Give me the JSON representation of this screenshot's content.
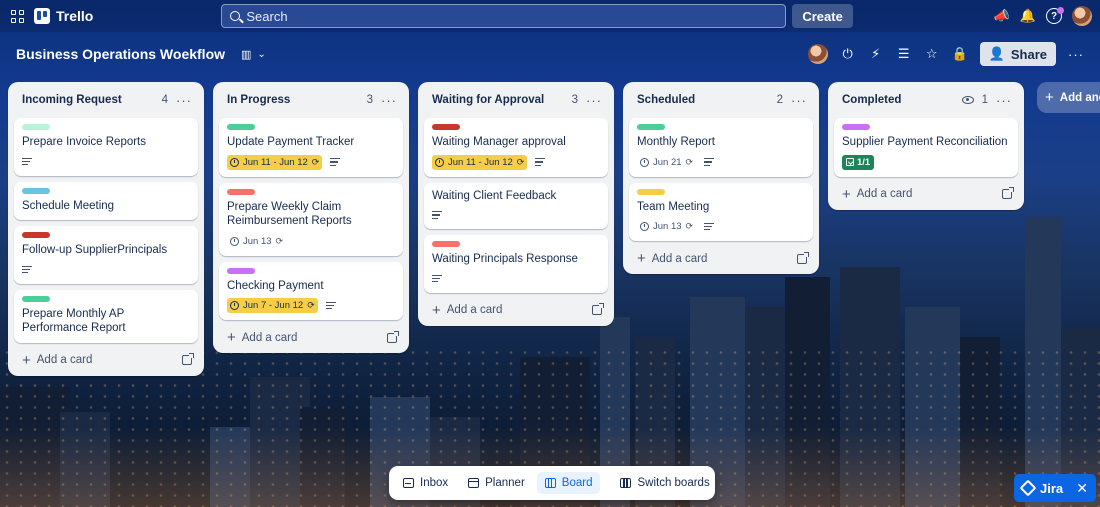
{
  "topbar": {
    "app_name": "Trello",
    "search_placeholder": "Search",
    "create_label": "Create"
  },
  "board": {
    "title": "Business Operations Woekflow",
    "share_label": "Share"
  },
  "colors": {
    "green": "#4bce97",
    "teal": "#6cc3e0",
    "red": "#c9372c",
    "pink": "#f87168",
    "purple": "#c971f5",
    "yellow": "#f5cd47",
    "mint": "#baf3db"
  },
  "lists": [
    {
      "title": "Incoming Request",
      "count": "4",
      "add_label": "Add a card",
      "cards": [
        {
          "title": "Prepare Invoice Reports"
        },
        {
          "title": "Schedule Meeting"
        },
        {
          "title": "Follow-up SupplierPrincipals"
        },
        {
          "title": "Prepare Monthly AP Performance Report"
        }
      ]
    },
    {
      "title": "In Progress",
      "count": "3",
      "add_label": "Add a card",
      "cards": [
        {
          "title": "Update Payment Tracker",
          "date": "Jun 11 - Jun 12"
        },
        {
          "title": "Prepare Weekly Claim Reimbursement Reports",
          "date": "Jun 13"
        },
        {
          "title": "Checking Payment",
          "date": "Jun 7 - Jun 12"
        }
      ]
    },
    {
      "title": "Waiting for Approval",
      "count": "3",
      "add_label": "Add a card",
      "cards": [
        {
          "title": "Waiting Manager approval",
          "date": "Jun 11 - Jun 12"
        },
        {
          "title": "Waiting Client Feedback"
        },
        {
          "title": "Waiting Principals Response"
        }
      ]
    },
    {
      "title": "Scheduled",
      "count": "2",
      "add_label": "Add a card",
      "cards": [
        {
          "title": "Monthly Report",
          "date": "Jun 21"
        },
        {
          "title": "Team Meeting",
          "date": "Jun 13"
        }
      ]
    },
    {
      "title": "Completed",
      "count": "1",
      "add_label": "Add a card",
      "cards": [
        {
          "title": "Supplier Payment Reconciliation",
          "checklist": "1/1"
        }
      ]
    }
  ],
  "add_list_label": "Add another list",
  "switcher": {
    "inbox": "Inbox",
    "planner": "Planner",
    "board": "Board",
    "switch": "Switch boards"
  },
  "jira_label": "Jira"
}
